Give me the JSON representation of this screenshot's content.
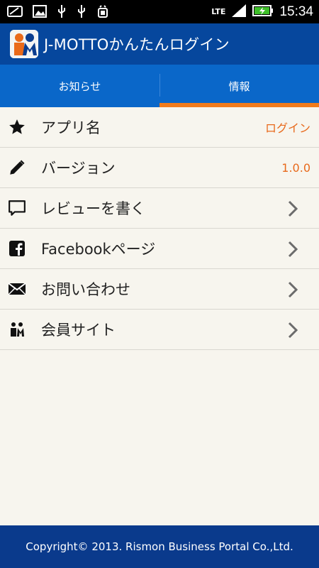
{
  "status_bar": {
    "network": "LTE",
    "time": "15:34",
    "icons": [
      "message-icon",
      "image-icon",
      "usb-icon",
      "usb-icon",
      "android-debug-icon",
      "signal-icon",
      "battery-charging-icon"
    ]
  },
  "header": {
    "title": "J-MOTTOかんたんログイン",
    "logo_icon": "jmotto-logo-icon"
  },
  "tabs": [
    {
      "label": "お知らせ",
      "active": false
    },
    {
      "label": "情報",
      "active": true
    }
  ],
  "list": [
    {
      "icon": "star-icon",
      "label": "アプリ名",
      "value": "ログイン"
    },
    {
      "icon": "pencil-icon",
      "label": "バージョン",
      "value": "1.0.0"
    },
    {
      "icon": "comment-icon",
      "label": "レビューを書く",
      "chevron": true
    },
    {
      "icon": "facebook-icon",
      "label": "Facebookページ",
      "chevron": true
    },
    {
      "icon": "mail-icon",
      "label": "お問い合わせ",
      "chevron": true
    },
    {
      "icon": "members-icon",
      "label": "会員サイト",
      "chevron": true
    }
  ],
  "footer": {
    "copyright": "Copyright© 2013. Rismon Business Portal Co.,Ltd."
  },
  "colors": {
    "header_bg": "#06479d",
    "tab_bg": "#0a67c9",
    "accent": "#f07b1c",
    "value_text": "#e8691b",
    "footer_bg": "#0a3a8c",
    "list_bg": "#f7f5ee"
  }
}
